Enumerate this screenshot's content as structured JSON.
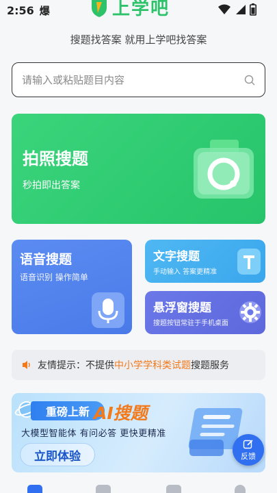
{
  "status_bar": {
    "time": "2:56",
    "extra": "爆"
  },
  "logo": {
    "text": "上学吧"
  },
  "slogan": "搜题找答案 就用上学吧找答案",
  "search": {
    "placeholder": "请输入或粘贴题目内容"
  },
  "photo_search": {
    "title": "拍照搜题",
    "subtitle": "秒拍即出答案"
  },
  "voice_search": {
    "title": "语音搜题",
    "subtitle": "语音识别 操作简单"
  },
  "text_search": {
    "title": "文字搜题",
    "subtitle": "手动输入 答案更精准"
  },
  "float_search": {
    "title": "悬浮窗搜题",
    "subtitle": "搜题按钮常驻于手机桌面"
  },
  "notice": {
    "prefix": "友情提示：不提供",
    "highlight": "中小学学科类试题",
    "suffix": "搜题服务"
  },
  "banner": {
    "tag": "重磅上新",
    "title": "AI搜题",
    "description": "大模型智能体  有问必答  更快更精准",
    "button": "立即体验"
  },
  "feedback": {
    "label": "反馈"
  },
  "colors": {
    "brand_green": "#2ec36b",
    "voice_blue": "#5b8cf2",
    "text_blue": "#4fb8f3",
    "float_purple": "#6b78e8",
    "highlight_orange": "#f27a1b",
    "feedback_blue": "#2f6ff0"
  },
  "icons": [
    "wifi-icon",
    "signal-icon",
    "battery-icon",
    "search-icon",
    "camera-icon",
    "microphone-icon",
    "text-t-icon",
    "gear-icon",
    "speaker-icon",
    "edit-icon"
  ]
}
